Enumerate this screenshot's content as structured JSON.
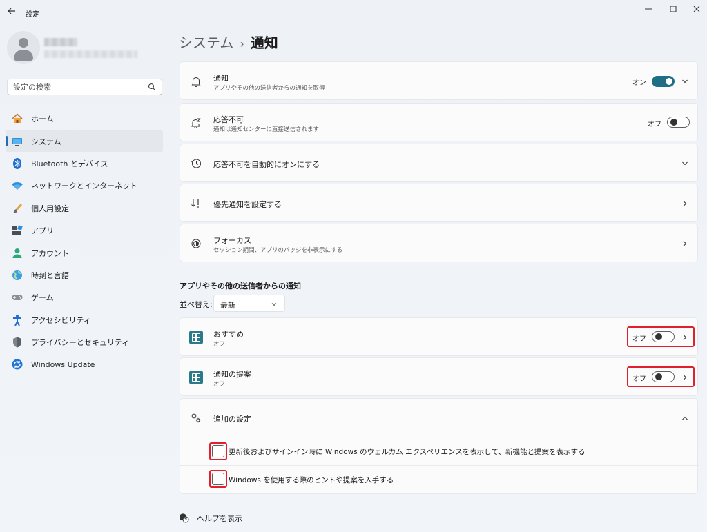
{
  "window": {
    "title": "設定"
  },
  "sidebar": {
    "search_placeholder": "設定の検索",
    "items": [
      {
        "label": "ホーム",
        "icon": "home-icon"
      },
      {
        "label": "システム",
        "icon": "system-icon",
        "active": true
      },
      {
        "label": "Bluetooth とデバイス",
        "icon": "bluetooth-icon"
      },
      {
        "label": "ネットワークとインターネット",
        "icon": "wifi-icon"
      },
      {
        "label": "個人用設定",
        "icon": "brush-icon"
      },
      {
        "label": "アプリ",
        "icon": "apps-icon"
      },
      {
        "label": "アカウント",
        "icon": "account-icon"
      },
      {
        "label": "時刻と言語",
        "icon": "globe-icon"
      },
      {
        "label": "ゲーム",
        "icon": "gamepad-icon"
      },
      {
        "label": "アクセシビリティ",
        "icon": "accessibility-icon"
      },
      {
        "label": "プライバシーとセキュリティ",
        "icon": "shield-icon"
      },
      {
        "label": "Windows Update",
        "icon": "update-icon"
      }
    ]
  },
  "breadcrumb": {
    "parent": "システム",
    "separator": "›",
    "current": "通知"
  },
  "settings": {
    "notifications": {
      "title": "通知",
      "subtitle": "アプリやその他の送信者からの通知を取得",
      "state_label": "オン"
    },
    "dnd": {
      "title": "応答不可",
      "subtitle": "通知は通知センターに直接送信されます",
      "state_label": "オフ"
    },
    "auto_dnd": {
      "title": "応答不可を自動的にオンにする"
    },
    "priority": {
      "title": "優先通知を設定する"
    },
    "focus": {
      "title": "フォーカス",
      "subtitle": "セッション期間、アプリのバッジを非表示にする"
    }
  },
  "apps_section": {
    "title": "アプリやその他の送信者からの通知",
    "sort_label": "並べ替え:",
    "sort_value": "最新",
    "apps": [
      {
        "title": "おすすめ",
        "subtitle": "オフ",
        "state_label": "オフ"
      },
      {
        "title": "通知の提案",
        "subtitle": "オフ",
        "state_label": "オフ"
      }
    ]
  },
  "additional": {
    "title": "追加の設定",
    "options": [
      "更新後およびサインイン時に Windows のウェルカム エクスペリエンスを表示して、新機能と提案を表示する",
      "Windows を使用する際のヒントや提案を入手する"
    ]
  },
  "help": {
    "label": "ヘルプを表示"
  },
  "colors": {
    "accent": "#1e6e86",
    "highlight": "#e0202b",
    "nav_indicator": "#1f6fb2"
  }
}
